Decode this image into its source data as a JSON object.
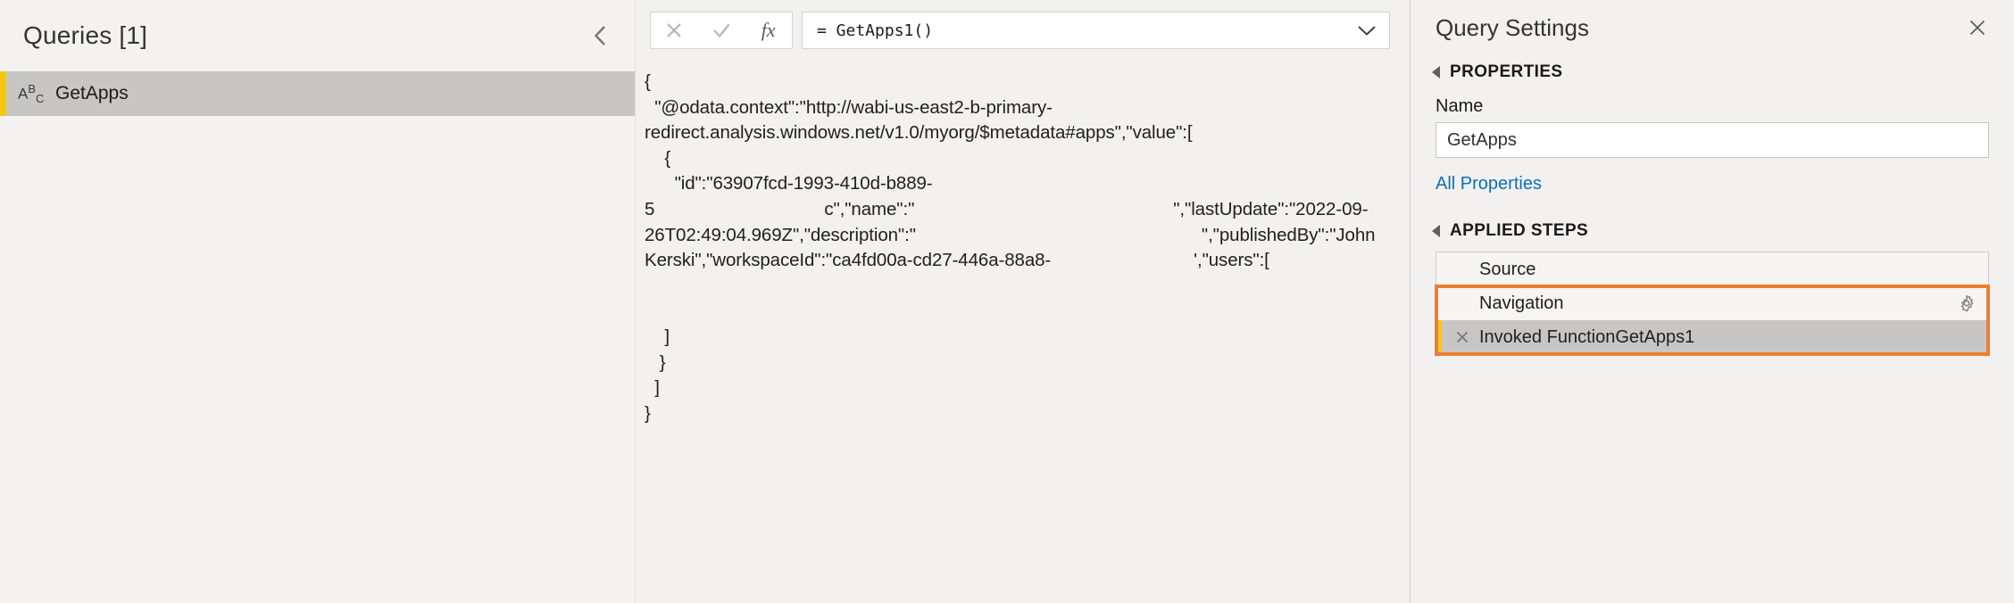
{
  "queries_pane": {
    "title": "Queries [1]",
    "collapse_icon": "chevron-left-icon",
    "items": [
      {
        "icon": "abc-text-type-icon",
        "icon_a": "A",
        "icon_b": "B",
        "icon_c": "C",
        "label": "GetApps"
      }
    ]
  },
  "formula_bar": {
    "cancel_icon": "close-x-icon",
    "accept_icon": "checkmark-icon",
    "fx_label": "fx",
    "formula": "= GetApps1()",
    "dropdown_icon": "chevron-down-icon"
  },
  "preview": {
    "lines": [
      "{",
      "  \"@odata.context\":\"http://wabi-us-east2-b-primary-",
      "redirect.analysis.windows.net/v1.0/myorg/$metadata#apps\",\"value\":[",
      "    {",
      "      \"id\":\"63907fcd-1993-410d-b889-",
      "c\",\"name\":\"\",\"lastUpdate\":\"2022-09-",
      "26T02:49:04.969Z\",\"description\":\"\",\"publishedBy\":\"John",
      "Kerski\",\"workspaceId\":\"ca4fd00a-cd27-446a-88a8-",
      "',\"users\":[",
      "",
      "    ]",
      "   }",
      "  ]",
      "}"
    ],
    "line_fragments": [
      [
        {
          "t": "{",
          "indent": 0
        }
      ],
      [
        {
          "t": "  \"@odata.context\":\"http://wabi-us-east2-b-primary-"
        }
      ],
      [
        {
          "t": "redirect.analysis.windows.net/v1.0/myorg/$metadata#apps\",\"value\":["
        }
      ],
      [
        {
          "t": "    {"
        }
      ],
      [
        {
          "t": "      \"id\":\"63907fcd-1993-410d-b889-"
        }
      ],
      [
        {
          "t": "5"
        },
        {
          "redact": 190
        },
        {
          "t": "c\",\"name\":\""
        },
        {
          "redact": 290
        },
        {
          "t": "\",\"lastUpdate\":\"2022-09-"
        }
      ],
      [
        {
          "t": "26T02:49:04.969Z\",\"description\":\""
        },
        {
          "redact": 320
        },
        {
          "t": "\",\"publishedBy\":\"John"
        }
      ],
      [
        {
          "t": "Kerski\",\"workspaceId\":\"ca4fd00a-cd27-446a-88a8-"
        },
        {
          "redact": 160
        },
        {
          "t": "',\"users\":["
        }
      ],
      [
        {
          "t": ""
        }
      ],
      [
        {
          "t": ""
        }
      ],
      [
        {
          "t": "    ]"
        }
      ],
      [
        {
          "t": "   }"
        }
      ],
      [
        {
          "t": "  ]"
        }
      ],
      [
        {
          "t": "}"
        }
      ]
    ]
  },
  "settings": {
    "title": "Query Settings",
    "close_icon": "close-x-icon",
    "properties_section": {
      "heading": "PROPERTIES",
      "name_label": "Name",
      "name_value": "GetApps",
      "all_properties_link": "All Properties"
    },
    "applied_steps_section": {
      "heading": "APPLIED STEPS",
      "steps": [
        {
          "label": "Source",
          "selected": false,
          "has_gear": false,
          "has_delete": false
        },
        {
          "label": "Navigation",
          "selected": false,
          "has_gear": true,
          "has_delete": false
        },
        {
          "label": "Invoked FunctionGetApps1",
          "selected": true,
          "has_gear": false,
          "has_delete": true
        }
      ]
    }
  },
  "annotations": {
    "highlight_color": "#ED7D31",
    "accent_yellow": "#F2C811",
    "link_blue": "#0F6CBD"
  }
}
